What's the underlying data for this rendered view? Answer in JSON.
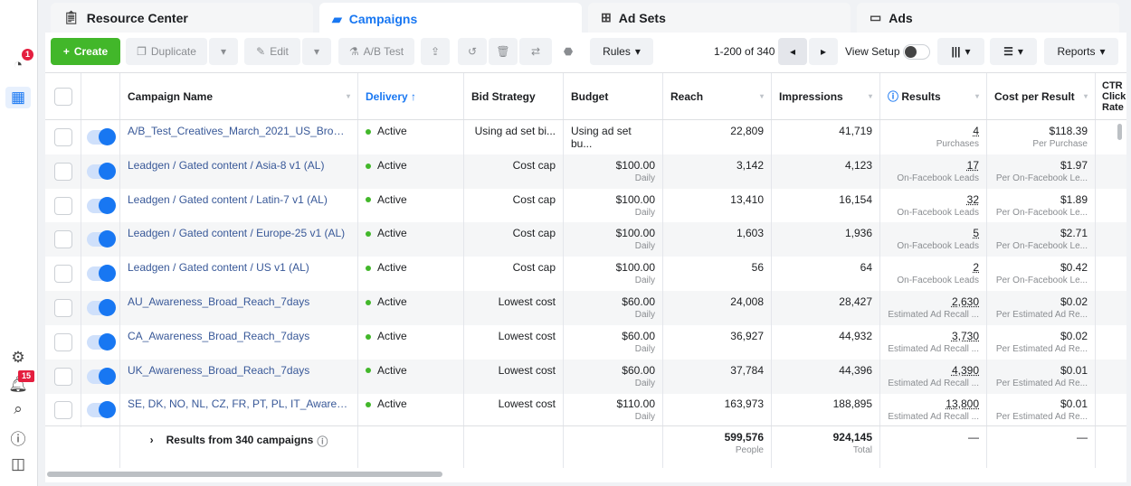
{
  "sidebar": {
    "items": [
      {
        "icon": "dashboard-icon",
        "badge": "1"
      },
      {
        "icon": "campaigns-table-icon"
      },
      {
        "icon": "gear-icon"
      },
      {
        "icon": "bell-icon",
        "badge": "15"
      },
      {
        "icon": "search-icon"
      },
      {
        "icon": "help-icon"
      },
      {
        "icon": "panel-toggle-icon"
      }
    ]
  },
  "tabs": [
    {
      "label": "Resource Center",
      "icon": "clipboard-icon"
    },
    {
      "label": "Campaigns",
      "icon": "campaign-folder-icon",
      "active": true
    },
    {
      "label": "Ad Sets",
      "icon": "grid-icon"
    },
    {
      "label": "Ads",
      "icon": "window-icon"
    }
  ],
  "toolbar": {
    "create": "Create",
    "duplicate": "Duplicate",
    "edit": "Edit",
    "ab_test": "A/B Test",
    "rules": "Rules",
    "pagination": "1-200 of 340",
    "view_setup": "View Setup",
    "reports": "Reports"
  },
  "columns": [
    "Campaign Name",
    "Delivery ↑",
    "Bid Strategy",
    "Budget",
    "Reach",
    "Impressions",
    "Results",
    "Cost per Result",
    "CTR Click Rate"
  ],
  "rows": [
    {
      "name": "A/B_Test_Creatives_March_2021_US_Broad_...",
      "delivery": "Active",
      "bid": "Using ad set bi...",
      "budget": "Using ad set bu...",
      "budget_sub": "",
      "reach": "22,809",
      "impressions": "41,719",
      "results": "4",
      "results_sub": "Purchases",
      "cpr": "$118.39",
      "cpr_sub": "Per Purchase"
    },
    {
      "name": "Leadgen / Gated content / Asia-8 v1 (AL)",
      "delivery": "Active",
      "bid": "Cost cap",
      "budget": "$100.00",
      "budget_sub": "Daily",
      "reach": "3,142",
      "impressions": "4,123",
      "results": "17",
      "results_sub": "On-Facebook Leads",
      "cpr": "$1.97",
      "cpr_sub": "Per On-Facebook Le..."
    },
    {
      "name": "Leadgen / Gated content / Latin-7 v1 (AL)",
      "delivery": "Active",
      "bid": "Cost cap",
      "budget": "$100.00",
      "budget_sub": "Daily",
      "reach": "13,410",
      "impressions": "16,154",
      "results": "32",
      "results_sub": "On-Facebook Leads",
      "cpr": "$1.89",
      "cpr_sub": "Per On-Facebook Le..."
    },
    {
      "name": "Leadgen / Gated content / Europe-25 v1 (AL)",
      "delivery": "Active",
      "bid": "Cost cap",
      "budget": "$100.00",
      "budget_sub": "Daily",
      "reach": "1,603",
      "impressions": "1,936",
      "results": "5",
      "results_sub": "On-Facebook Leads",
      "cpr": "$2.71",
      "cpr_sub": "Per On-Facebook Le..."
    },
    {
      "name": "Leadgen / Gated content / US v1 (AL)",
      "delivery": "Active",
      "bid": "Cost cap",
      "budget": "$100.00",
      "budget_sub": "Daily",
      "reach": "56",
      "impressions": "64",
      "results": "2",
      "results_sub": "On-Facebook Leads",
      "cpr": "$0.42",
      "cpr_sub": "Per On-Facebook Le..."
    },
    {
      "name": "AU_Awareness_Broad_Reach_7days",
      "delivery": "Active",
      "bid": "Lowest cost",
      "budget": "$60.00",
      "budget_sub": "Daily",
      "reach": "24,008",
      "impressions": "28,427",
      "results": "2,630",
      "results_sub": "Estimated Ad Recall ...",
      "cpr": "$0.02",
      "cpr_sub": "Per Estimated Ad Re..."
    },
    {
      "name": "CA_Awareness_Broad_Reach_7days",
      "delivery": "Active",
      "bid": "Lowest cost",
      "budget": "$60.00",
      "budget_sub": "Daily",
      "reach": "36,927",
      "impressions": "44,932",
      "results": "3,730",
      "results_sub": "Estimated Ad Recall ...",
      "cpr": "$0.02",
      "cpr_sub": "Per Estimated Ad Re..."
    },
    {
      "name": "UK_Awareness_Broad_Reach_7days",
      "delivery": "Active",
      "bid": "Lowest cost",
      "budget": "$60.00",
      "budget_sub": "Daily",
      "reach": "37,784",
      "impressions": "44,396",
      "results": "4,390",
      "results_sub": "Estimated Ad Recall ...",
      "cpr": "$0.01",
      "cpr_sub": "Per Estimated Ad Re..."
    },
    {
      "name": "SE, DK, NO, NL, CZ, FR, PT, PL, IT_Awareness_...",
      "delivery": "Active",
      "bid": "Lowest cost",
      "budget": "$110.00",
      "budget_sub": "Daily",
      "reach": "163,973",
      "impressions": "188,895",
      "results": "13,800",
      "results_sub": "Estimated Ad Recall ...",
      "cpr": "$0.01",
      "cpr_sub": "Per Estimated Ad Re..."
    }
  ],
  "footer": {
    "label": "Results from 340 campaigns",
    "reach": "599,576",
    "reach_sub": "People",
    "impressions": "924,145",
    "impressions_sub": "Total",
    "results": "—",
    "cpr": "—"
  },
  "colors": {
    "accent": "#1877f2",
    "create": "#42b72a",
    "link": "#385898",
    "active": "#42b72a",
    "badge": "#e41e3f"
  }
}
